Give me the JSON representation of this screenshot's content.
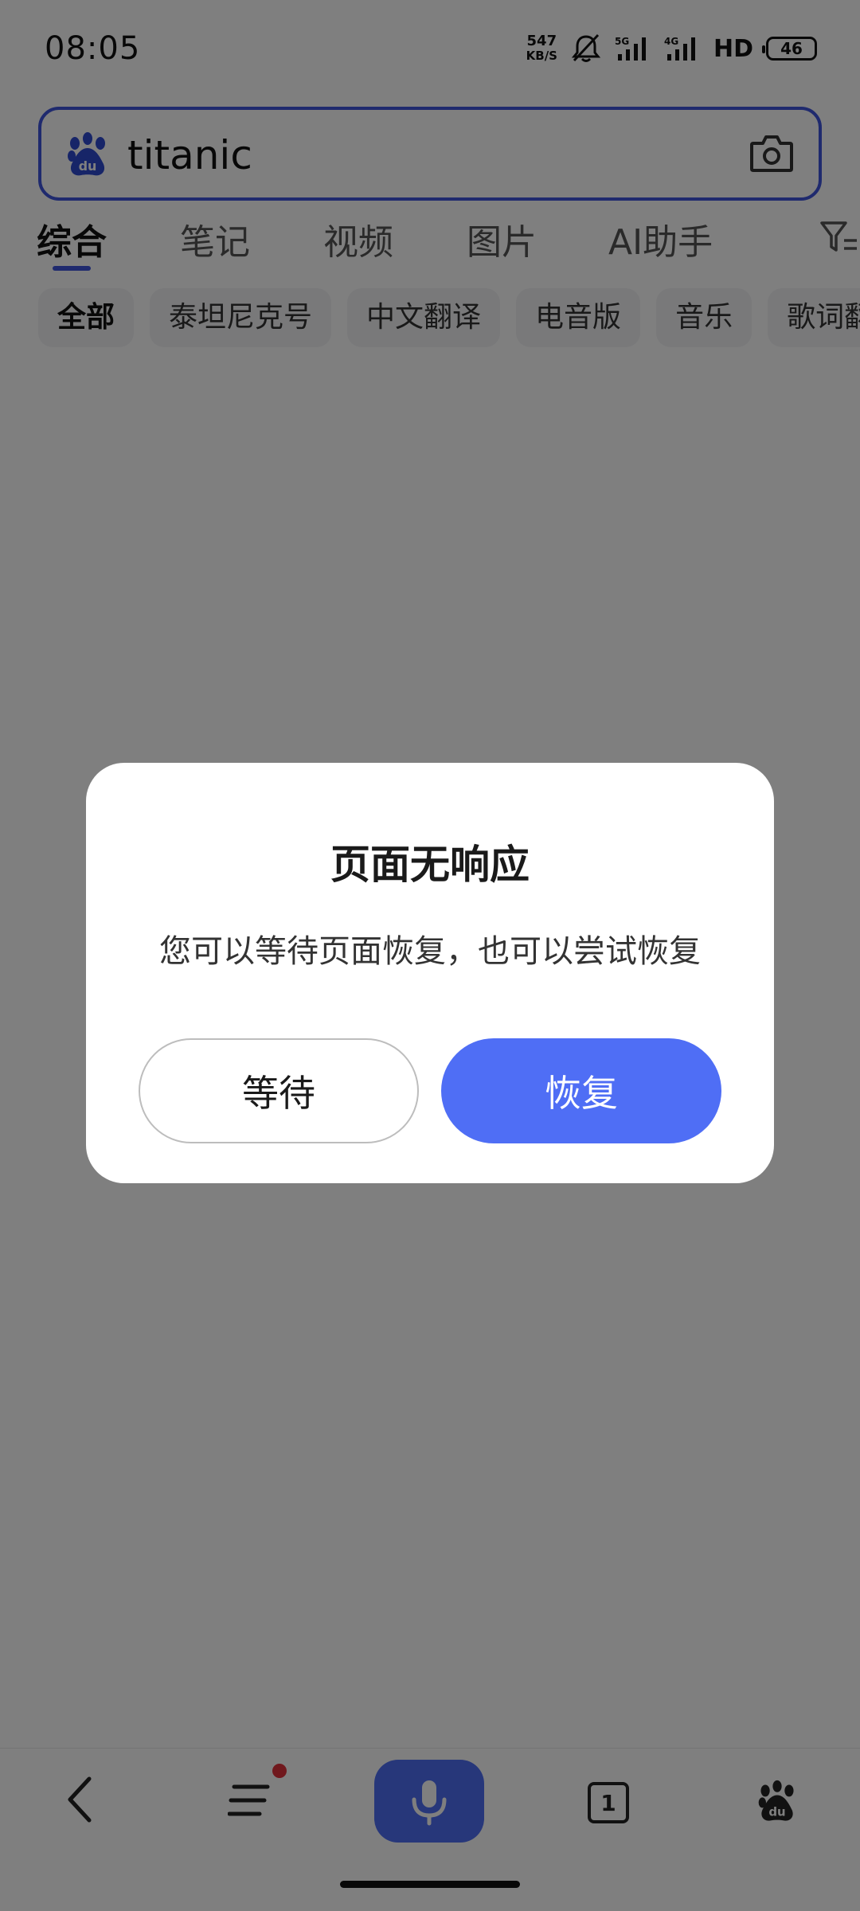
{
  "status_bar": {
    "time": "08:05",
    "net_speed_value": "547",
    "net_speed_unit": "KB/S",
    "signal_5g": "5G",
    "signal_4g": "4G",
    "hd": "HD",
    "battery": "46"
  },
  "search": {
    "query": "titanic"
  },
  "tabs": [
    {
      "label": "综合",
      "active": true
    },
    {
      "label": "笔记"
    },
    {
      "label": "视频"
    },
    {
      "label": "图片"
    },
    {
      "label": "AI助手"
    }
  ],
  "chips": [
    {
      "label": "全部",
      "active": true
    },
    {
      "label": "泰坦尼克号"
    },
    {
      "label": "中文翻译"
    },
    {
      "label": "电音版"
    },
    {
      "label": "音乐"
    },
    {
      "label": "歌词翻译"
    }
  ],
  "dialog": {
    "title": "页面无响应",
    "message": "您可以等待页面恢复，也可以尝试恢复",
    "wait_label": "等待",
    "restore_label": "恢复"
  },
  "bottom_nav": {
    "tab_count": "1"
  },
  "colors": {
    "accent": "#4f6ef5",
    "search_border": "#3e54dd",
    "notification_dot": "#e0303a"
  }
}
